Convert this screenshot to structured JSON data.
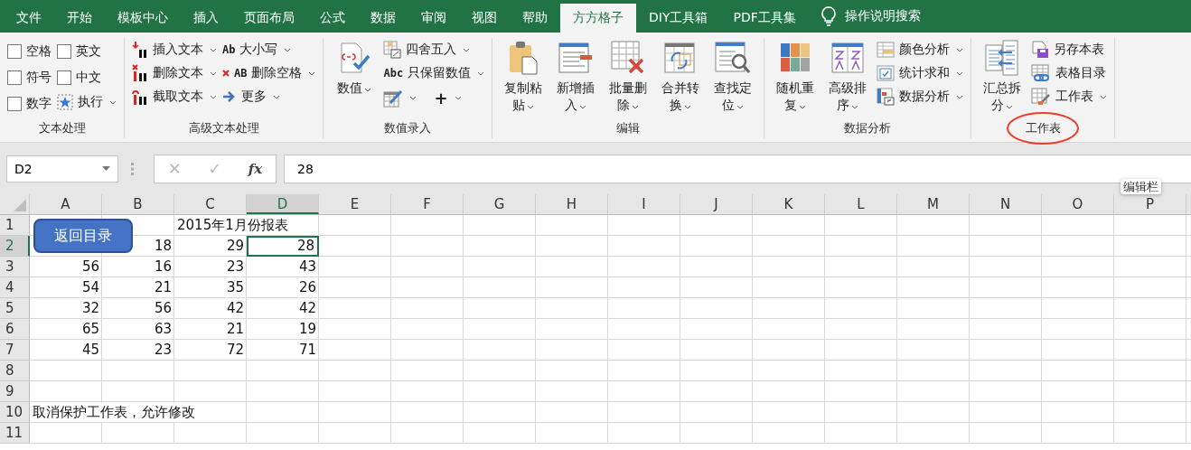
{
  "tabs": [
    {
      "label": "文件",
      "selected": false
    },
    {
      "label": "开始",
      "selected": false
    },
    {
      "label": "模板中心",
      "selected": false
    },
    {
      "label": "插入",
      "selected": false
    },
    {
      "label": "页面布局",
      "selected": false
    },
    {
      "label": "公式",
      "selected": false
    },
    {
      "label": "数据",
      "selected": false
    },
    {
      "label": "审阅",
      "selected": false
    },
    {
      "label": "视图",
      "selected": false
    },
    {
      "label": "帮助",
      "selected": false
    },
    {
      "label": "方方格子",
      "selected": true
    },
    {
      "label": "DIY工具箱",
      "selected": false
    },
    {
      "label": "PDF工具集",
      "selected": false
    }
  ],
  "tell_me": {
    "placeholder": "操作说明搜索"
  },
  "ribbon_groups": [
    {
      "label": "文本处理",
      "columns": [
        {
          "items": [
            {
              "kind": "checkbox",
              "label": "空格",
              "checked": false
            },
            {
              "kind": "checkbox",
              "label": "符号",
              "checked": false
            },
            {
              "kind": "checkbox",
              "label": "数字",
              "checked": false
            }
          ]
        },
        {
          "items": [
            {
              "kind": "checkbox",
              "label": "英文",
              "checked": false
            },
            {
              "kind": "checkbox",
              "label": "中文",
              "checked": false
            },
            {
              "kind": "small",
              "label": "执行",
              "dropdown": true
            }
          ]
        }
      ]
    },
    {
      "label": "高级文本处理",
      "columns": [
        {
          "items": [
            {
              "kind": "small",
              "label": "插入文本",
              "dropdown": true
            },
            {
              "kind": "small",
              "label": "删除文本",
              "dropdown": true
            },
            {
              "kind": "small",
              "label": "截取文本",
              "dropdown": true
            }
          ]
        },
        {
          "items": [
            {
              "kind": "small",
              "glyph": "Ab",
              "label": "大小写",
              "dropdown": true
            },
            {
              "kind": "small",
              "glyph": "AB",
              "label": "删除空格",
              "dropdown": true
            },
            {
              "kind": "small",
              "label": "更多",
              "dropdown": true
            }
          ]
        }
      ]
    },
    {
      "label": "数值录入",
      "columns": [
        {
          "items": [
            {
              "kind": "large",
              "label": "数值",
              "dropdown": true
            }
          ]
        },
        {
          "items": [
            {
              "kind": "small",
              "label": "四舍五入",
              "dropdown": true
            },
            {
              "kind": "small",
              "glyph": "Abc",
              "label": "只保留数值",
              "dropdown": true
            },
            {
              "kind": "split",
              "parts": [
                {
                  "dropdown": true
                },
                {
                  "glyph": "+",
                  "dropdown": true
                }
              ]
            }
          ]
        }
      ]
    },
    {
      "label": "编辑",
      "columns": [
        {
          "items": [
            {
              "kind": "large",
              "label": "复制粘贴",
              "dropdown": true
            }
          ]
        },
        {
          "items": [
            {
              "kind": "large",
              "label": "新增插入",
              "dropdown": true
            }
          ]
        },
        {
          "items": [
            {
              "kind": "large",
              "label": "批量删除",
              "dropdown": true
            }
          ]
        },
        {
          "items": [
            {
              "kind": "large",
              "label": "合并转换",
              "dropdown": true
            }
          ]
        },
        {
          "items": [
            {
              "kind": "large",
              "label": "查找定位",
              "dropdown": true
            }
          ]
        }
      ]
    },
    {
      "label": "数据分析",
      "columns": [
        {
          "items": [
            {
              "kind": "large",
              "label": "随机重复",
              "dropdown": true
            }
          ]
        },
        {
          "items": [
            {
              "kind": "large",
              "label": "高级排序",
              "dropdown": true
            }
          ]
        },
        {
          "items": [
            {
              "kind": "small",
              "label": "颜色分析",
              "dropdown": true
            },
            {
              "kind": "small",
              "label": "统计求和",
              "dropdown": true
            },
            {
              "kind": "small",
              "label": "数据分析",
              "dropdown": true
            }
          ]
        }
      ]
    },
    {
      "label": "工作表",
      "highlighted": true,
      "columns": [
        {
          "items": [
            {
              "kind": "large",
              "label": "汇总拆分",
              "dropdown": true
            }
          ]
        },
        {
          "items": [
            {
              "kind": "small",
              "label": "另存本表",
              "dropdown": false
            },
            {
              "kind": "small",
              "label": "表格目录",
              "dropdown": false
            },
            {
              "kind": "small",
              "label": "工作表",
              "dropdown": true
            }
          ]
        }
      ]
    }
  ],
  "formula_bar": {
    "name_box": "D2",
    "cancel": {
      "label": "✕",
      "disabled": true
    },
    "enter": {
      "label": "✓",
      "disabled": true
    },
    "function": {
      "label": "fx",
      "disabled": false
    },
    "value": "28"
  },
  "tooltip": {
    "text": "编辑栏"
  },
  "sheet": {
    "columns": [
      {
        "label": "A",
        "selected": false
      },
      {
        "label": "B",
        "selected": false
      },
      {
        "label": "C",
        "selected": false
      },
      {
        "label": "D",
        "selected": true
      },
      {
        "label": "E",
        "selected": false
      },
      {
        "label": "F",
        "selected": false
      },
      {
        "label": "G",
        "selected": false
      },
      {
        "label": "H",
        "selected": false
      },
      {
        "label": "I",
        "selected": false
      },
      {
        "label": "J",
        "selected": false
      },
      {
        "label": "K",
        "selected": false
      },
      {
        "label": "L",
        "selected": false
      },
      {
        "label": "M",
        "selected": false
      },
      {
        "label": "N",
        "selected": false
      },
      {
        "label": "O",
        "selected": false
      },
      {
        "label": "P",
        "selected": false
      }
    ],
    "rows": [
      {
        "header": "1",
        "selected": false,
        "cells": [
          null,
          null,
          {
            "text": "2015年1月份报表",
            "kind": "text",
            "selected": false
          },
          null
        ]
      },
      {
        "header": "2",
        "selected": true,
        "cells": [
          null,
          {
            "text": "18",
            "kind": "number",
            "selected": false
          },
          {
            "text": "29",
            "kind": "number",
            "selected": false
          },
          {
            "text": "28",
            "kind": "number",
            "selected": true
          }
        ]
      },
      {
        "header": "3",
        "selected": false,
        "cells": [
          {
            "text": "56",
            "kind": "number",
            "selected": false
          },
          {
            "text": "16",
            "kind": "number",
            "selected": false
          },
          {
            "text": "23",
            "kind": "number",
            "selected": false
          },
          {
            "text": "43",
            "kind": "number",
            "selected": false
          }
        ]
      },
      {
        "header": "4",
        "selected": false,
        "cells": [
          {
            "text": "54",
            "kind": "number",
            "selected": false
          },
          {
            "text": "21",
            "kind": "number",
            "selected": false
          },
          {
            "text": "35",
            "kind": "number",
            "selected": false
          },
          {
            "text": "26",
            "kind": "number",
            "selected": false
          }
        ]
      },
      {
        "header": "5",
        "selected": false,
        "cells": [
          {
            "text": "32",
            "kind": "number",
            "selected": false
          },
          {
            "text": "56",
            "kind": "number",
            "selected": false
          },
          {
            "text": "42",
            "kind": "number",
            "selected": false
          },
          {
            "text": "42",
            "kind": "number",
            "selected": false
          }
        ]
      },
      {
        "header": "6",
        "selected": false,
        "cells": [
          {
            "text": "65",
            "kind": "number",
            "selected": false
          },
          {
            "text": "63",
            "kind": "number",
            "selected": false
          },
          {
            "text": "21",
            "kind": "number",
            "selected": false
          },
          {
            "text": "19",
            "kind": "number",
            "selected": false
          }
        ]
      },
      {
        "header": "7",
        "selected": false,
        "cells": [
          {
            "text": "45",
            "kind": "number",
            "selected": false
          },
          {
            "text": "23",
            "kind": "number",
            "selected": false
          },
          {
            "text": "72",
            "kind": "number",
            "selected": false
          },
          {
            "text": "71",
            "kind": "number",
            "selected": false
          }
        ]
      },
      {
        "header": "8",
        "selected": false
      },
      {
        "header": "9",
        "selected": false
      },
      {
        "header": "10",
        "selected": false,
        "cells": [
          {
            "text": "取消保护工作表，允许修改",
            "kind": "text",
            "selected": false
          }
        ]
      },
      {
        "header": "11",
        "selected": false
      }
    ],
    "shape_button": {
      "label": "返回目录"
    }
  }
}
